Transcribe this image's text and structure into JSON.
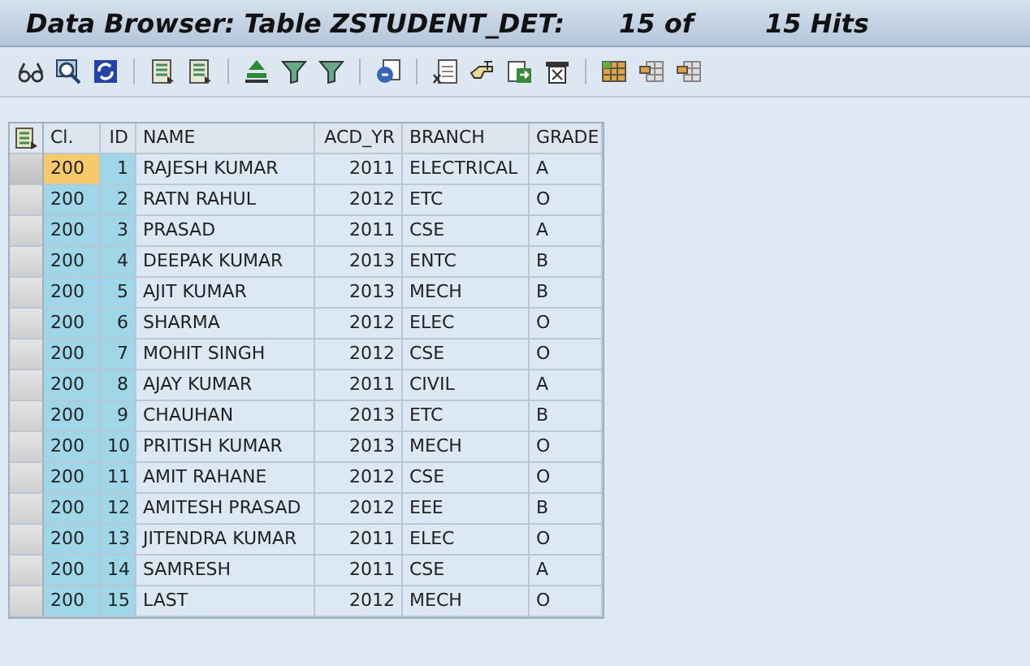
{
  "window": {
    "title": "Data Browser: Table ZSTUDENT_DET:",
    "hits_shown": "15 of",
    "hits_total": "15 Hits"
  },
  "table": {
    "columns": [
      {
        "label": "Cl.",
        "key": true,
        "kind": "text"
      },
      {
        "label": "ID",
        "key": true,
        "kind": "number"
      },
      {
        "label": "NAME",
        "key": false,
        "kind": "text"
      },
      {
        "label": "ACD_YR",
        "key": false,
        "kind": "number"
      },
      {
        "label": "BRANCH",
        "key": false,
        "kind": "text"
      },
      {
        "label": "GRADE",
        "key": false,
        "kind": "text"
      }
    ],
    "rows": [
      {
        "cells": [
          "200",
          "1",
          "RAJESH KUMAR",
          "2011",
          "ELECTRICAL",
          "A"
        ],
        "selected": true
      },
      {
        "cells": [
          "200",
          "2",
          "RATN RAHUL",
          "2012",
          "ETC",
          "O"
        ],
        "selected": false
      },
      {
        "cells": [
          "200",
          "3",
          "PRASAD",
          "2011",
          "CSE",
          "A"
        ],
        "selected": false
      },
      {
        "cells": [
          "200",
          "4",
          "DEEPAK KUMAR",
          "2013",
          "ENTC",
          "B"
        ],
        "selected": false
      },
      {
        "cells": [
          "200",
          "5",
          "AJIT KUMAR",
          "2013",
          "MECH",
          "B"
        ],
        "selected": false
      },
      {
        "cells": [
          "200",
          "6",
          "SHARMA",
          "2012",
          "ELEC",
          "O"
        ],
        "selected": false
      },
      {
        "cells": [
          "200",
          "7",
          "MOHIT SINGH",
          "2012",
          "CSE",
          "O"
        ],
        "selected": false
      },
      {
        "cells": [
          "200",
          "8",
          "AJAY KUMAR",
          "2011",
          "CIVIL",
          "A"
        ],
        "selected": false
      },
      {
        "cells": [
          "200",
          "9",
          "CHAUHAN",
          "2013",
          "ETC",
          "B"
        ],
        "selected": false
      },
      {
        "cells": [
          "200",
          "10",
          "PRITISH KUMAR",
          "2013",
          "MECH",
          "O"
        ],
        "selected": false
      },
      {
        "cells": [
          "200",
          "11",
          "AMIT RAHANE",
          "2012",
          "CSE",
          "O"
        ],
        "selected": false
      },
      {
        "cells": [
          "200",
          "12",
          "AMITESH PRASAD",
          "2012",
          "EEE",
          "B"
        ],
        "selected": false
      },
      {
        "cells": [
          "200",
          "13",
          "JITENDRA KUMAR",
          "2011",
          "ELEC",
          "O"
        ],
        "selected": false
      },
      {
        "cells": [
          "200",
          "14",
          "SAMRESH",
          "2011",
          "CSE",
          "A"
        ],
        "selected": false
      },
      {
        "cells": [
          "200",
          "15",
          "LAST",
          "2012",
          "MECH",
          "O"
        ],
        "selected": false
      }
    ]
  }
}
